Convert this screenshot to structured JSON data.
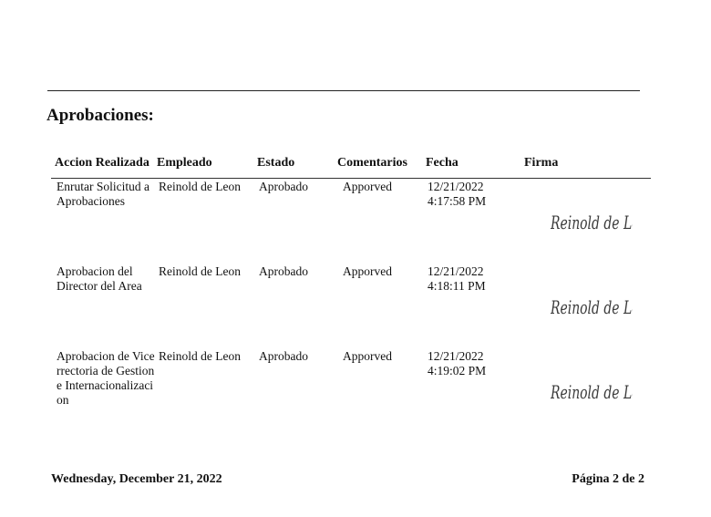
{
  "section": {
    "title": "Aprobaciones:"
  },
  "table": {
    "headers": {
      "accion": "Accion Realizada",
      "empleado": "Empleado",
      "estado": "Estado",
      "comentarios": "Comentarios",
      "fecha": "Fecha",
      "firma": "Firma"
    },
    "rows": [
      {
        "accion": "Enrutar Solicitud a Aprobaciones",
        "empleado": "Reinold de Leon",
        "estado": "Aprobado",
        "comentarios": "Apporved",
        "fecha": "12/21/2022\n4:17:58 PM",
        "firma": "Reinold de León"
      },
      {
        "accion": "Aprobacion del Director del Area",
        "empleado": "Reinold de Leon",
        "estado": "Aprobado",
        "comentarios": "Apporved",
        "fecha": "12/21/2022\n4:18:11 PM",
        "firma": "Reinold de León"
      },
      {
        "accion": "Aprobacion de Vicerrectoria de Gestion e Internacionalizacion",
        "empleado": "Reinold de Leon",
        "estado": "Aprobado",
        "comentarios": "Apporved",
        "fecha": "12/21/2022\n4:19:02 PM",
        "firma": "Reinold de León"
      }
    ]
  },
  "footer": {
    "date": "Wednesday, December 21, 2022",
    "page": "Página 2 de 2"
  }
}
